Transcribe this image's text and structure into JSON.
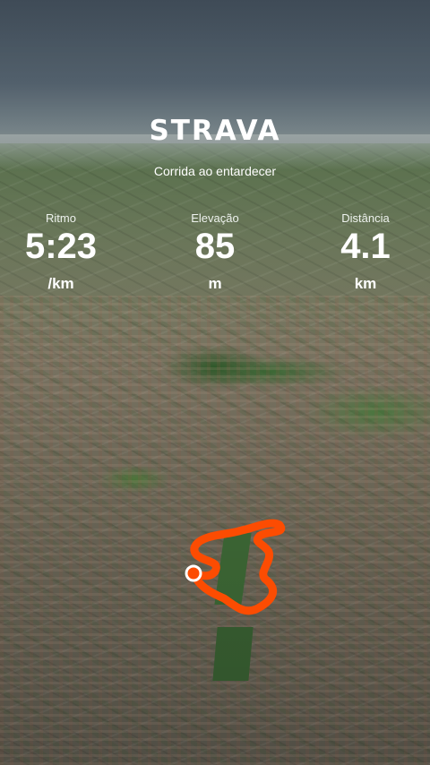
{
  "brand": {
    "logo_text": "STRAVA",
    "accent_color": "#fc4c02"
  },
  "activity": {
    "title": "Corrida ao entardecer"
  },
  "stats": [
    {
      "label": "Ritmo",
      "value": "5:23",
      "unit": "/km"
    },
    {
      "label": "Elevação",
      "value": "85",
      "unit": "m"
    },
    {
      "label": "Distância",
      "value": "4.1",
      "unit": "km"
    }
  ],
  "map": {
    "view": "satellite-3d",
    "route_color": "#fc4c02",
    "marker_color": "#fc4c02"
  }
}
